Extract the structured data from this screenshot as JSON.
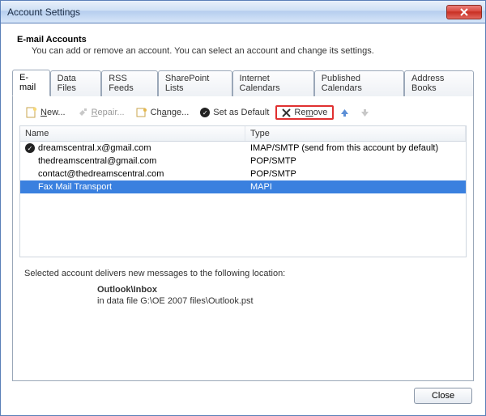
{
  "window": {
    "title": "Account Settings"
  },
  "header": {
    "title": "E-mail Accounts",
    "subtitle": "You can add or remove an account. You can select an account and change its settings."
  },
  "tabs": {
    "items": [
      {
        "label": "E-mail"
      },
      {
        "label": "Data Files"
      },
      {
        "label": "RSS Feeds"
      },
      {
        "label": "SharePoint Lists"
      },
      {
        "label": "Internet Calendars"
      },
      {
        "label": "Published Calendars"
      },
      {
        "label": "Address Books"
      }
    ]
  },
  "toolbar": {
    "new_label": "New...",
    "repair_label": "Repair...",
    "change_label": "Change...",
    "default_label": "Set as Default",
    "remove_label": "Remove"
  },
  "grid": {
    "columns": {
      "name": "Name",
      "type": "Type"
    },
    "rows": [
      {
        "default": true,
        "name": "dreamscentral.x@gmail.com",
        "type": "IMAP/SMTP (send from this account by default)"
      },
      {
        "default": false,
        "name": "thedreamscentral@gmail.com",
        "type": "POP/SMTP"
      },
      {
        "default": false,
        "name": "contact@thedreamscentral.com",
        "type": "POP/SMTP"
      },
      {
        "default": false,
        "name": "Fax Mail Transport",
        "type": "MAPI",
        "selected": true
      }
    ]
  },
  "footer": {
    "line1": "Selected account delivers new messages to the following location:",
    "location_bold": "Outlook\\Inbox",
    "location_path": "in data file G:\\OE 2007 files\\Outlook.pst"
  },
  "buttons": {
    "close": "Close"
  }
}
